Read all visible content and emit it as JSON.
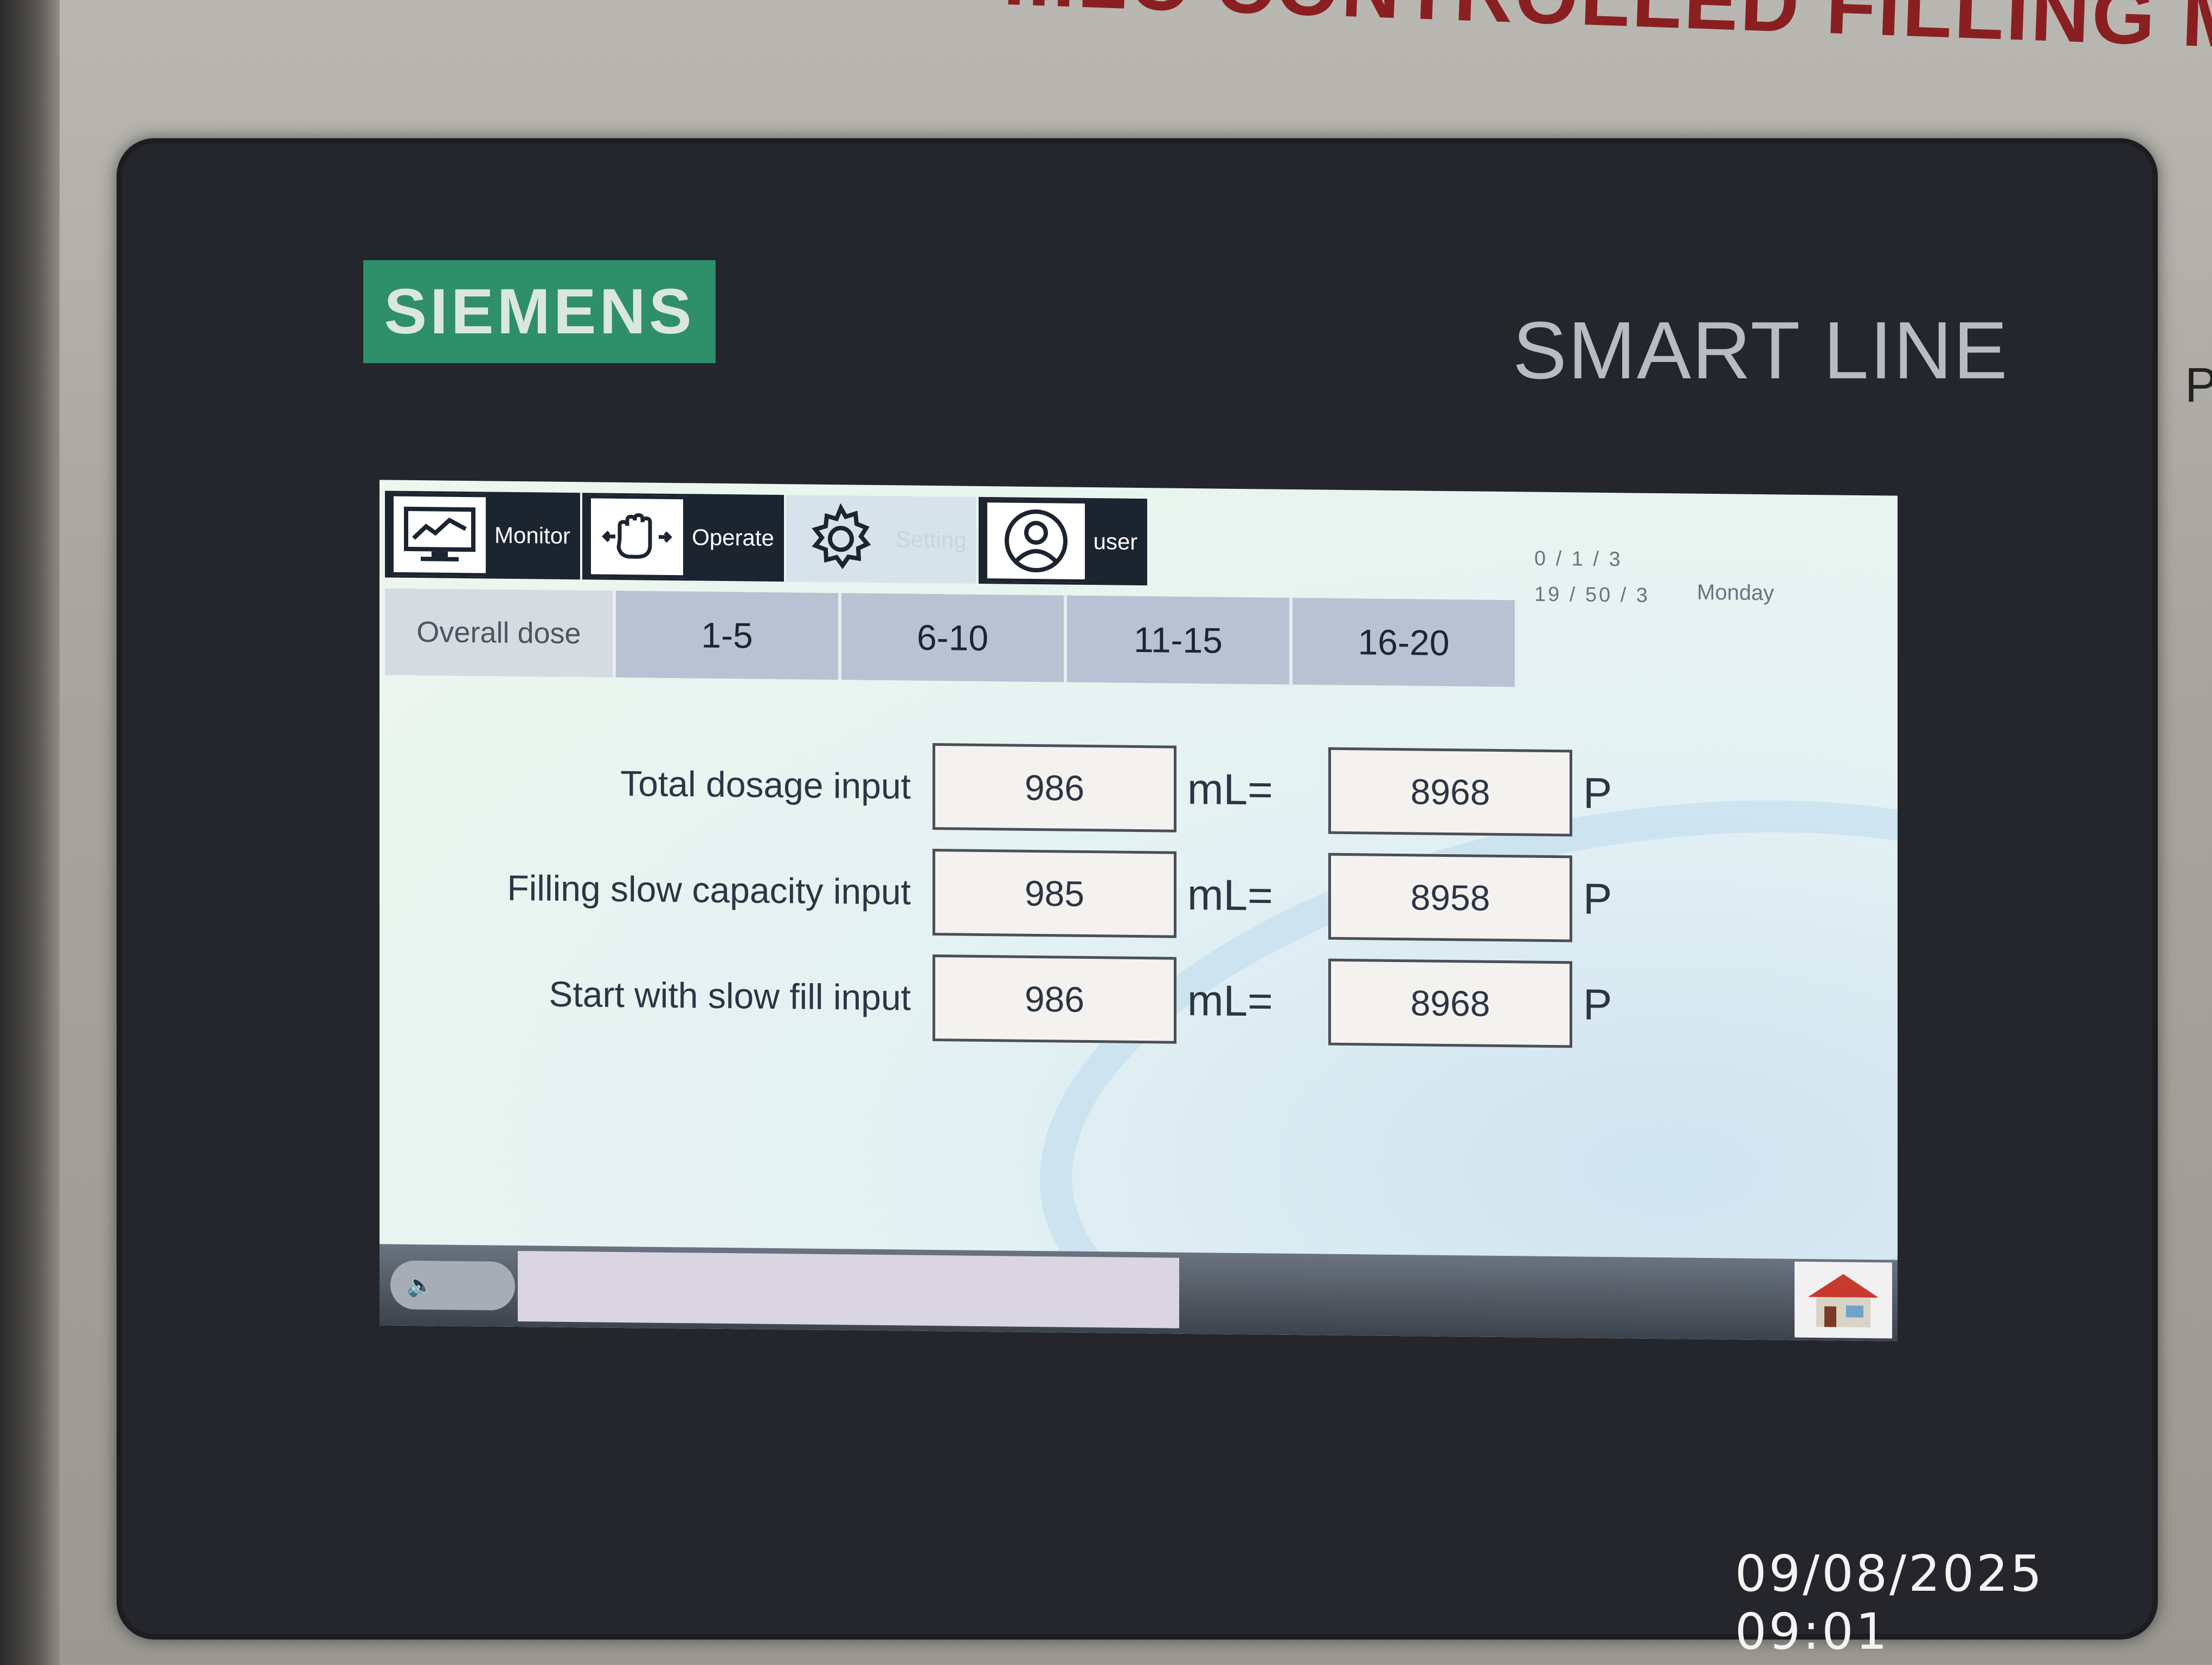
{
  "machine_plate": {
    "text": "...LC CONTROLLED FILLING MACH",
    "edge_glyph": "P"
  },
  "hmi_brand": {
    "vendor": "SIEMENS",
    "model": "SMART LINE"
  },
  "navigation": [
    {
      "label": "Monitor",
      "icon": "monitor-chart-icon"
    },
    {
      "label": "Operate",
      "icon": "hand-icon"
    },
    {
      "label": "Setting",
      "icon": "gear-icon"
    },
    {
      "label": "user",
      "icon": "user-icon"
    }
  ],
  "datetime": {
    "line1": "0 / 1 / 3",
    "line2": "19 / 50 / 3",
    "weekday": "Monday"
  },
  "tabs": [
    {
      "label": "Overall dose",
      "active": true
    },
    {
      "label": "1-5"
    },
    {
      "label": "6-10"
    },
    {
      "label": "11-15"
    },
    {
      "label": "16-20"
    }
  ],
  "rows": [
    {
      "label": "Total dosage input",
      "ml_value": "986",
      "unit": "mL=",
      "p_value": "8968",
      "p_unit": "P"
    },
    {
      "label": "Filling slow capacity input",
      "ml_value": "985",
      "unit": "mL=",
      "p_value": "8958",
      "p_unit": "P"
    },
    {
      "label": "Start with slow fill input",
      "ml_value": "986",
      "unit": "mL=",
      "p_value": "8968",
      "p_unit": "P"
    }
  ],
  "statusbar": {
    "speaker_icon": "speaker-icon",
    "message": "",
    "home_icon": "home-icon"
  },
  "photo_timestamp": "09/08/2025 09:01",
  "colors": {
    "brand_green": "#2f8f6a",
    "tab_bg": "#b9c2d2",
    "nav_dark": "#1c2430"
  }
}
